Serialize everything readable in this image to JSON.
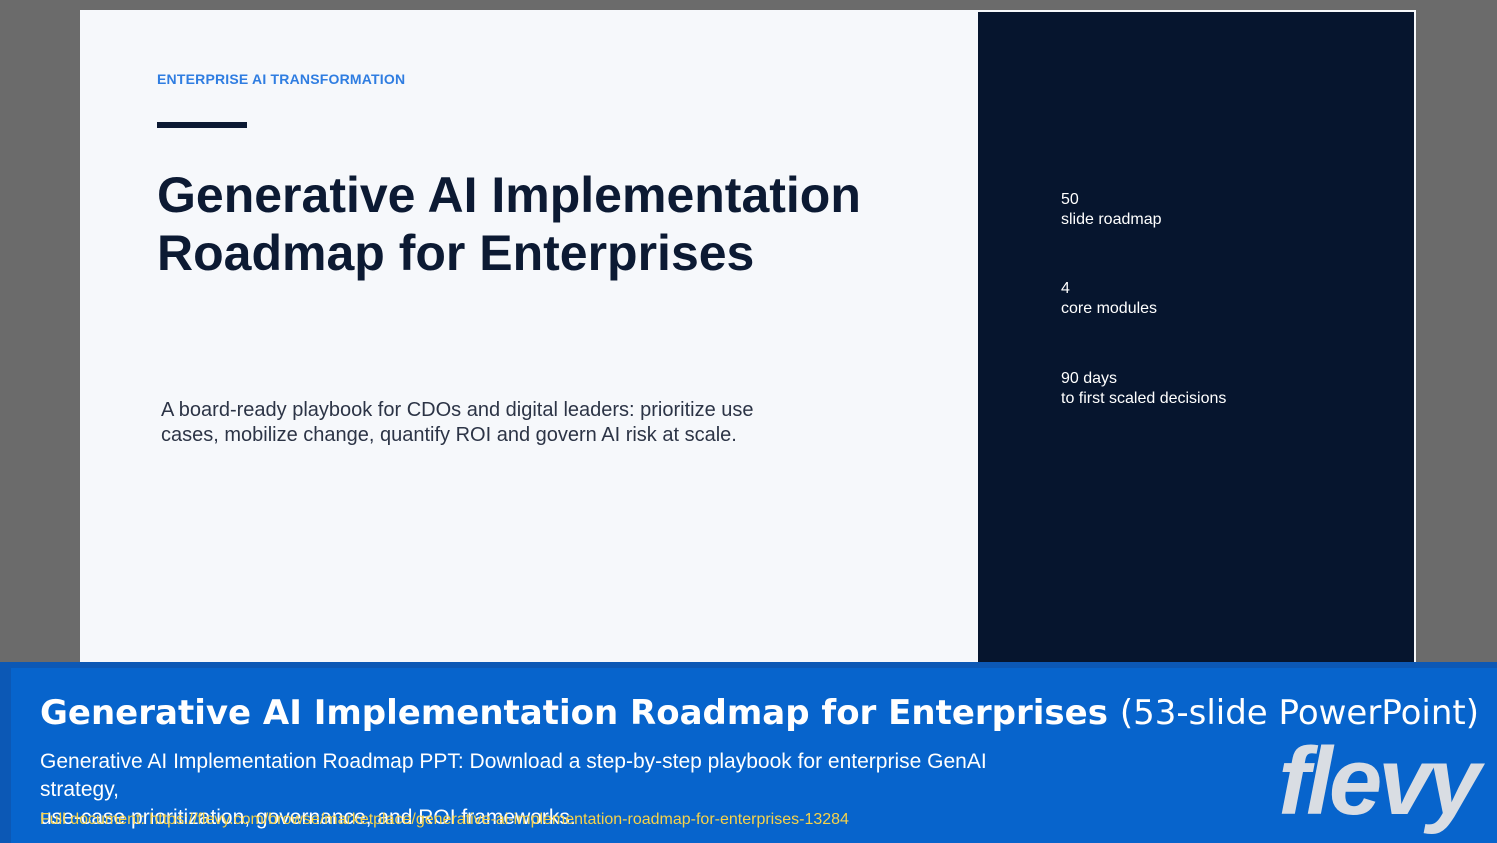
{
  "slide": {
    "eyebrow": "ENTERPRISE AI TRANSFORMATION",
    "title_line1": "Generative AI Implementation",
    "title_line2": "Roadmap for Enterprises",
    "subtitle_line1": "A board-ready playbook for CDOs and digital leaders: prioritize use",
    "subtitle_line2": "cases, mobilize change, quantify ROI and govern AI risk at scale.",
    "stats": [
      {
        "value": "50",
        "label": "slide roadmap"
      },
      {
        "value": "4",
        "label": "core modules"
      },
      {
        "value": "90 days",
        "label": "to first scaled decisions"
      }
    ]
  },
  "banner": {
    "title_main": "Generative AI Implementation Roadmap for Enterprises",
    "title_suffix": "(53-slide PowerPoint)",
    "desc_line1": "Generative AI Implementation Roadmap PPT: Download a step-by-step playbook for enterprise GenAI strategy,",
    "desc_line2": "use-case prioritization, governance, and ROI frameworks.",
    "link": "Full document: https://flevy.com/browse/marketplace/generative-ai-implementation-roadmap-for-enterprises-13284",
    "logo": "flevy"
  },
  "colors": {
    "slide_background": "#f6f8fb",
    "slide_dark_panel": "#06152e",
    "eyebrow_accent": "#2f7de1",
    "title_text": "#0c1a33",
    "banner_blue": "#0764cc",
    "link_yellow": "#f6d24a"
  }
}
